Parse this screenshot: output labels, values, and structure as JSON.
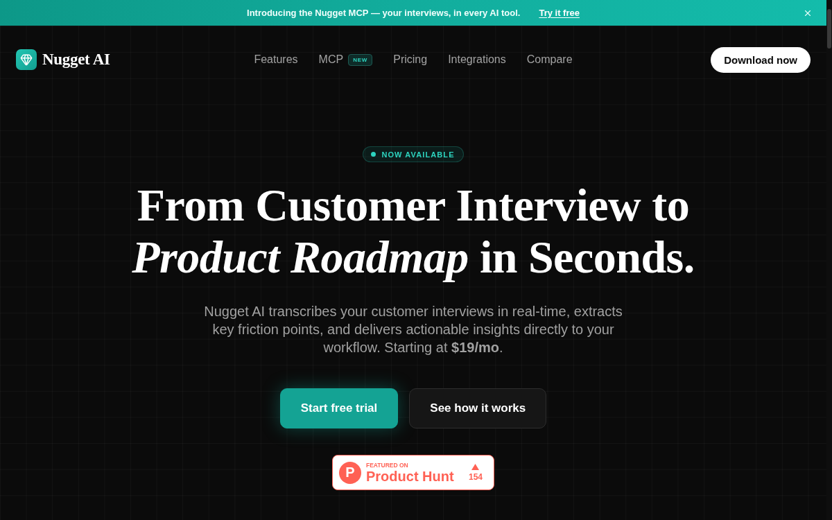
{
  "announcement": {
    "text": "Introducing the Nugget MCP — your interviews, in every AI tool.",
    "link": "Try it free"
  },
  "nav": {
    "brand": "Nugget AI",
    "links": [
      {
        "label": "Features"
      },
      {
        "label": "MCP",
        "badge": "NEW"
      },
      {
        "label": "Pricing"
      },
      {
        "label": "Integrations"
      },
      {
        "label": "Compare"
      }
    ],
    "cta": "Download now"
  },
  "hero": {
    "eyebrow": "NOW AVAILABLE",
    "headline": "From Customer Interview to *Product Roadmap* in Seconds.",
    "description": "Nugget AI transcribes your customer interviews in real-time, extracts key friction points, and delivers actionable insights directly to your workflow. Starting at **$19/mo**.",
    "buttons": [
      {
        "label": "Start free trial",
        "kind": "primary"
      },
      {
        "label": "See how it works",
        "kind": "secondary"
      }
    ],
    "product_hunt": {
      "logo_letter": "P",
      "kicker": "FEATURED ON",
      "name": "Product Hunt",
      "votes": "154"
    }
  }
}
